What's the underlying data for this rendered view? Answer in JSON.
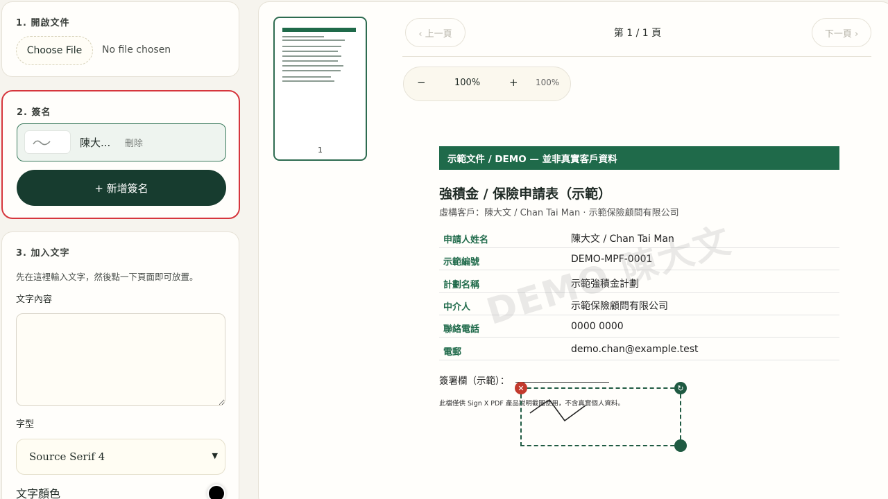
{
  "step1": {
    "title": "1. 開啟文件",
    "choose_file": "Choose File",
    "status": "No file chosen"
  },
  "step2": {
    "title": "2. 簽名",
    "signature": {
      "name": "陳大...",
      "delete": "刪除"
    },
    "add_button": "+ 新增簽名"
  },
  "step3": {
    "title": "3. 加入文字",
    "hint": "先在這裡輸入文字，然後點一下頁面即可放置。",
    "content_label": "文字內容",
    "content_value": "",
    "font_label": "字型",
    "font_value": "Source Serif 4",
    "color_label": "文字顏色",
    "color_value": "#000000"
  },
  "viewer": {
    "thumbnail_page": "1",
    "prev": "‹ 上一頁",
    "next": "下一頁 ›",
    "page_indicator": "第 1 / 1 頁",
    "zoom": {
      "minus": "−",
      "value": "100%",
      "plus": "+",
      "display": "100%"
    }
  },
  "document": {
    "header": "示範文件 / DEMO — 並非真實客戶資料",
    "title": "強積金 / 保險申請表（示範）",
    "subtitle": "虛構客戶：陳大文 / Chan Tai Man · 示範保險顧問有限公司",
    "rows": [
      {
        "key": "申請人姓名",
        "value": "陳大文 / Chan Tai Man"
      },
      {
        "key": "示範編號",
        "value": "DEMO-MPF-0001"
      },
      {
        "key": "計劃名稱",
        "value": "示範強積金計劃"
      },
      {
        "key": "中介人",
        "value": "示範保險顧問有限公司"
      },
      {
        "key": "聯絡電話",
        "value": "0000 0000"
      },
      {
        "key": "電郵",
        "value": "demo.chan@example.test"
      }
    ],
    "signature_label": "簽署欄（示範）：",
    "note": "此檔僅供 Sign X PDF 產品說明截圖使用，不含真實個人資料。",
    "watermark": "DEMO 陳大文"
  },
  "colors": {
    "accent": "#173c2f",
    "doc_green": "#1f6a4a",
    "highlight": "#d6363d",
    "delete_handle": "#c23a2d"
  }
}
